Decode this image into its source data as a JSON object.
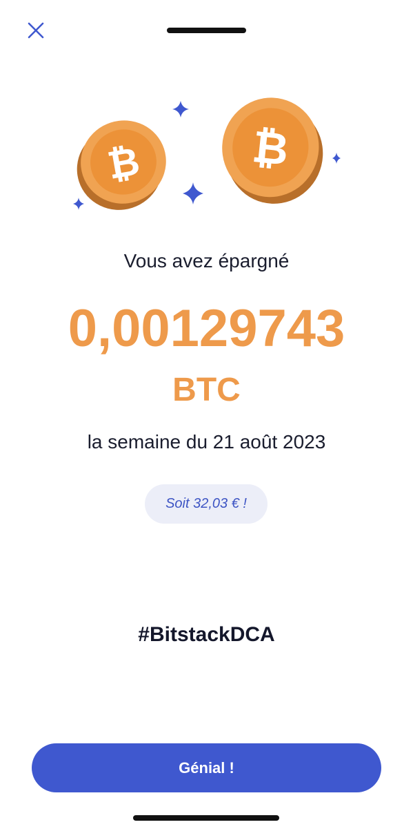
{
  "header": {
    "close_icon": "close-icon"
  },
  "hero": {
    "icons": [
      "bitcoin-coin-icon",
      "bitcoin-coin-icon",
      "sparkle-star-icon"
    ],
    "accent_color": "#ee9a4b",
    "star_color": "#3f58cf"
  },
  "summary": {
    "headline": "Vous avez épargné",
    "amount": "0,00129743",
    "currency": "BTC",
    "period": "la semaine du 21 août 2023",
    "fiat_equivalent": "Soit 32,03 € !",
    "hashtag": "#BitstackDCA"
  },
  "actions": {
    "primary_label": "Génial !",
    "primary_color": "#3f58cf"
  }
}
